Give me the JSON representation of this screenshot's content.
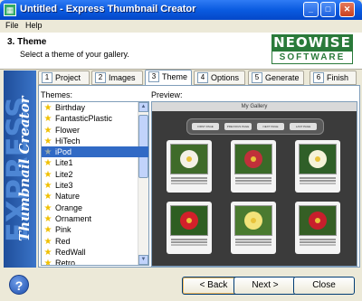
{
  "window": {
    "title": "Untitled - Express Thumbnail Creator",
    "app_icon": "grid-app-icon",
    "controls": [
      "minimize-icon",
      "maximize-icon",
      "close-icon"
    ]
  },
  "menu": {
    "items": [
      "File",
      "Help"
    ]
  },
  "header": {
    "step_title": "3. Theme",
    "step_description": "Select a theme of your gallery.",
    "logo_main": "NEOWISE",
    "logo_sub": "SOFTWARE"
  },
  "sidebar": {
    "brand_big": "EXPRESS",
    "brand_small": "Thumbnail Creator"
  },
  "tabs": [
    {
      "num": "1",
      "label": "Project"
    },
    {
      "num": "2",
      "label": "Images"
    },
    {
      "num": "3",
      "label": "Theme"
    },
    {
      "num": "4",
      "label": "Options"
    },
    {
      "num": "5",
      "label": "Generate"
    },
    {
      "num": "6",
      "label": "Finish"
    }
  ],
  "active_tab": "Theme",
  "themes_label": "Themes:",
  "preview_label": "Preview:",
  "themes": [
    "Birthday",
    "FantasticPlastic",
    "Flower",
    "HiTech",
    "iPod",
    "Lite1",
    "Lite2",
    "Lite3",
    "Nature",
    "Orange",
    "Ornament",
    "Pink",
    "Red",
    "RedWall",
    "Retro"
  ],
  "selected_theme": "iPod",
  "preview": {
    "gallery_title": "My Gallery",
    "nav_buttons": [
      "FIRST PAGE",
      "PREVIOUS PAGE",
      "NEXT PAGE",
      "LAST PAGE"
    ],
    "thumbnails": [
      {
        "flower": "white",
        "color": "#f4f1e6",
        "bg": "#3f6b2a"
      },
      {
        "flower": "red-white",
        "color": "#c0303a",
        "bg": "#3a6a28"
      },
      {
        "flower": "white-yellow",
        "color": "#f5f2d8",
        "bg": "#2f5f28"
      },
      {
        "flower": "red-rose",
        "color": "#d2202a",
        "bg": "#2e5e22"
      },
      {
        "flower": "yellow-rose",
        "color": "#f3e27a",
        "bg": "#4a7a30"
      },
      {
        "flower": "red-rose",
        "color": "#c81f2c",
        "bg": "#355f25"
      }
    ]
  },
  "buttons": {
    "back": "< Back",
    "next": "Next >",
    "close": "Close"
  },
  "help_label": "?"
}
